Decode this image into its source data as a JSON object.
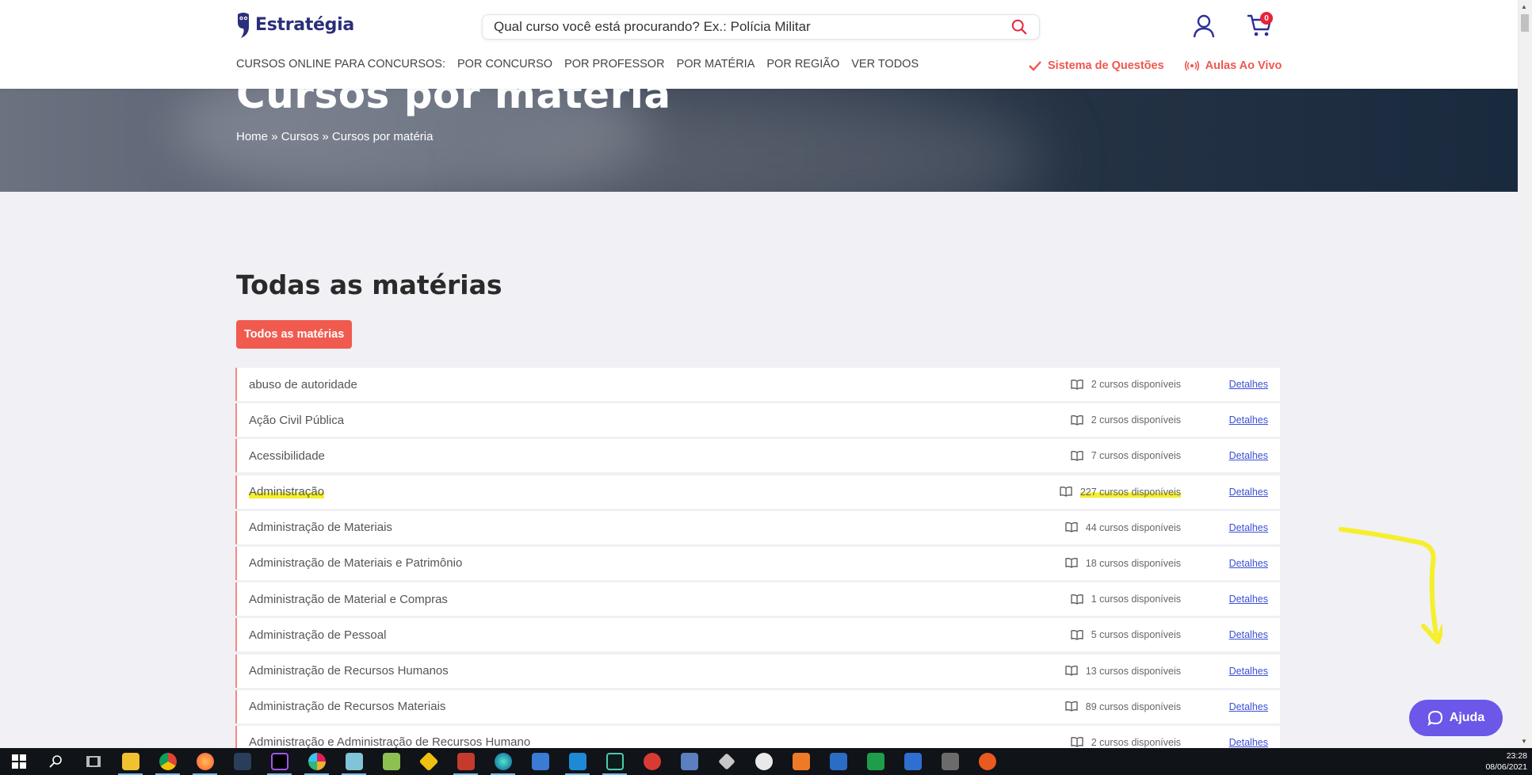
{
  "brand": {
    "name": "Estratégia"
  },
  "search": {
    "placeholder": "Qual curso você está procurando? Ex.: Polícia Militar"
  },
  "cart": {
    "count": "0"
  },
  "nav": {
    "items": [
      "CURSOS ONLINE PARA CONCURSOS:",
      "POR CONCURSO",
      "POR PROFESSOR",
      "POR MATÉRIA",
      "POR REGIÃO",
      "VER TODOS"
    ],
    "sistema_questoes": "Sistema de Questões",
    "aulas_ao_vivo": "Aulas Ao Vivo"
  },
  "hero": {
    "title": "Cursos por matéria",
    "breadcrumb": [
      "Home",
      "Cursos",
      "Cursos por matéria"
    ],
    "separator": "»"
  },
  "main": {
    "title": "Todas as matérias",
    "filter_button": "Todos as matérias",
    "details_label": "Detalhes",
    "rows": [
      {
        "name": "abuso de autoridade",
        "count": "2 cursos disponíveis"
      },
      {
        "name": "Ação Civil Pública",
        "count": "2 cursos disponíveis"
      },
      {
        "name": "Acessibilidade",
        "count": "7 cursos disponíveis"
      },
      {
        "name": "Administração",
        "count": "227 cursos disponíveis"
      },
      {
        "name": "Administração de Materiais",
        "count": "44 cursos disponíveis"
      },
      {
        "name": "Administração de Materiais e Patrimônio",
        "count": "18 cursos disponíveis"
      },
      {
        "name": "Administração de Material e Compras",
        "count": "1 cursos disponíveis"
      },
      {
        "name": "Administração de Pessoal",
        "count": "5 cursos disponíveis"
      },
      {
        "name": "Administração de Recursos Humanos",
        "count": "13 cursos disponíveis"
      },
      {
        "name": "Administração de Recursos Materiais",
        "count": "89 cursos disponíveis"
      },
      {
        "name": "Administração e Administração de Recursos Humano",
        "count": "2 cursos disponíveis"
      }
    ]
  },
  "help": {
    "label": "Ajuda"
  },
  "colors": {
    "brand": "#2b2f7a",
    "accent": "#f05a4f",
    "help": "#6b57e8",
    "link": "#3b4fd6",
    "highlight": "#f5ef2c"
  },
  "taskbar": {
    "icons": [
      "windows-start-icon",
      "search-icon",
      "task-view-icon",
      "file-explorer-icon",
      "chrome-icon",
      "firefox-icon",
      "app-icon",
      "jetbrains-icon",
      "slack-icon",
      "notepad-icon",
      "notepad-plus-icon",
      "git-icon",
      "postman-icon",
      "edge-icon",
      "app-icon",
      "vscode-icon",
      "terminal-icon",
      "git-gui-icon",
      "app-icon",
      "app-icon",
      "app-icon",
      "sublime-icon",
      "word-icon",
      "excel-icon",
      "media-player-icon",
      "calculator-icon",
      "app-icon"
    ],
    "time": "23:28",
    "date": "08/06/2021"
  }
}
